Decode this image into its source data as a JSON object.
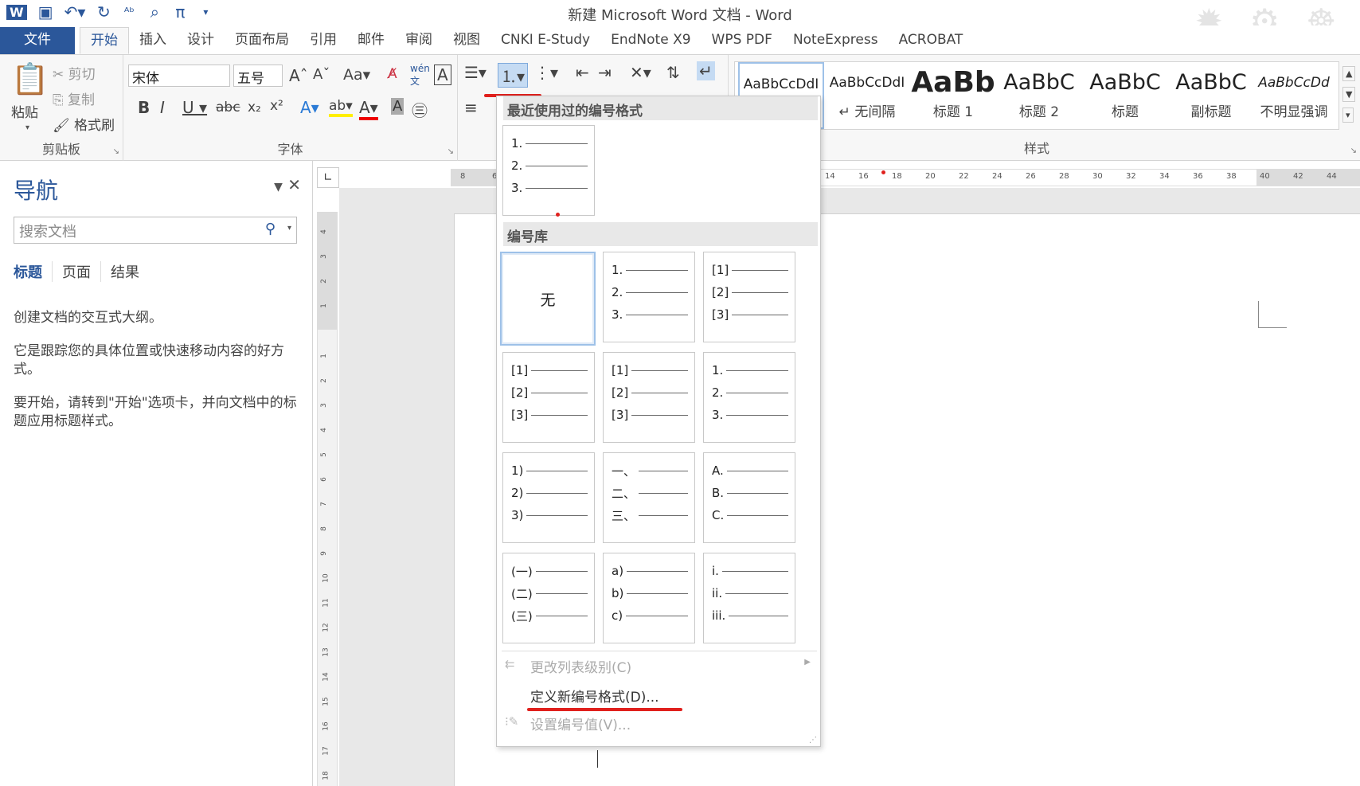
{
  "window": {
    "title": "新建 Microsoft Word 文档 - Word"
  },
  "qat": {
    "word_icon": "W",
    "save_icon": "save-icon",
    "undo_icon": "undo-icon",
    "redo_icon": "redo-icon",
    "spell_icon": "spell-icon",
    "preview_icon": "print-preview-icon",
    "pi_icon": "π",
    "more": "customize-qat-icon"
  },
  "tabs": [
    "文件",
    "开始",
    "插入",
    "设计",
    "页面布局",
    "引用",
    "邮件",
    "审阅",
    "视图",
    "CNKI E-Study",
    "EndNote X9",
    "WPS PDF",
    "NoteExpress",
    "ACROBAT"
  ],
  "ribbon": {
    "clipboard": {
      "paste": "粘贴",
      "cut": "剪切",
      "copy": "复制",
      "format_painter": "格式刷",
      "label": "剪贴板"
    },
    "font": {
      "font_name": "宋体",
      "font_size": "五号",
      "label": "字体"
    },
    "styles": {
      "label": "样式",
      "items": [
        {
          "preview": "AaBbCcDdI",
          "name": ""
        },
        {
          "preview": "AaBbCcDdI",
          "name": "↵ 无间隔"
        },
        {
          "preview": "AaBb",
          "name": "标题 1"
        },
        {
          "preview": "AaBbC",
          "name": "标题 2"
        },
        {
          "preview": "AaBbC",
          "name": "标题"
        },
        {
          "preview": "AaBbC",
          "name": "副标题"
        },
        {
          "preview": "AaBbCcDd",
          "name": "不明显强调"
        }
      ]
    }
  },
  "navigation": {
    "title": "导航",
    "search_placeholder": "搜索文档",
    "tabs": [
      "标题",
      "页面",
      "结果"
    ],
    "text": [
      "创建文档的交互式大纲。",
      "它是跟踪您的具体位置或快速移动内容的好方式。",
      "要开始，请转到\"开始\"选项卡，并向文档中的标题应用标题样式。"
    ]
  },
  "ruler": {
    "h_ticks": [
      "8",
      "6",
      "14",
      "16",
      "18",
      "20",
      "22",
      "24",
      "26",
      "28",
      "30",
      "32",
      "34",
      "36",
      "38",
      "40",
      "42",
      "44"
    ],
    "v_ticks": [
      "4",
      "3",
      "2",
      "1",
      "1",
      "2",
      "3",
      "4",
      "5",
      "6",
      "7",
      "8",
      "9",
      "10",
      "11",
      "12",
      "13",
      "14",
      "15",
      "16",
      "17",
      "18"
    ]
  },
  "numbering_menu": {
    "recent_header": "最近使用过的编号格式",
    "recent": [
      [
        "1.",
        "2.",
        "3."
      ]
    ],
    "library_header": "编号库",
    "none_label": "无",
    "library": [
      [
        "1.",
        "2.",
        "3."
      ],
      [
        "[1]",
        "[2]",
        "[3]"
      ],
      [
        "[1]",
        "[2]",
        "[3]"
      ],
      [
        "[1]",
        "[2]",
        "[3]"
      ],
      [
        "1.",
        "2.",
        "3."
      ],
      [
        "1)",
        "2)",
        "3)"
      ],
      [
        "一、",
        "二、",
        "三、"
      ],
      [
        "A.",
        "B.",
        "C."
      ],
      [
        "(一)",
        "(二)",
        "(三)"
      ],
      [
        "a)",
        "b)",
        "c)"
      ],
      [
        "i.",
        "ii.",
        "iii."
      ]
    ],
    "change_level": "更改列表级别(C)",
    "define_new": "定义新编号格式(D)...",
    "set_value": "设置编号值(V)..."
  },
  "colors": {
    "accent": "#2b579a",
    "highlight_red": "#e0201d"
  }
}
